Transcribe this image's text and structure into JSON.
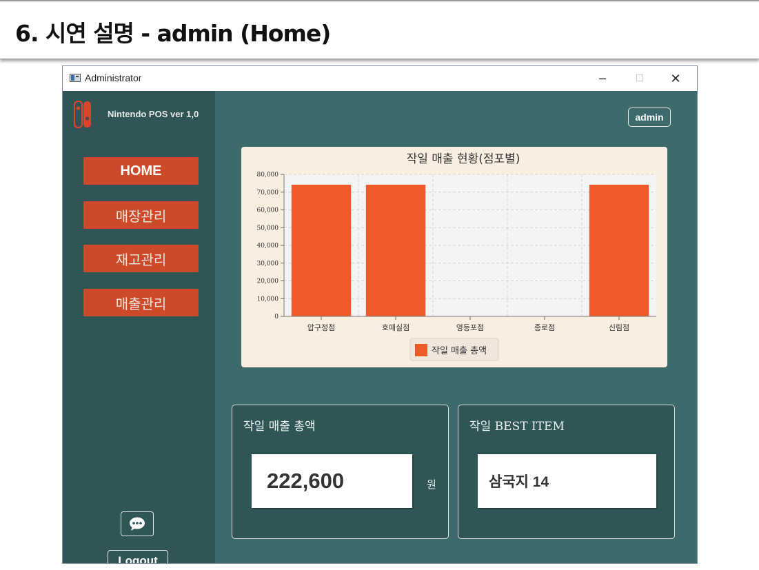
{
  "slide": {
    "title": "6. 시연 설명 - admin (Home)"
  },
  "window": {
    "title": "Administrator",
    "controls": {
      "minimize": "─",
      "maximize": "☐",
      "close": "✕"
    }
  },
  "sidebar": {
    "brand": "Nintendo POS ver 1,0",
    "nav": [
      {
        "label": "HOME",
        "active": true
      },
      {
        "label": "매장관리",
        "active": false
      },
      {
        "label": "재고관리",
        "active": false
      },
      {
        "label": "매출관리",
        "active": false
      }
    ],
    "chat_icon": "chat-bubble-icon",
    "logout_label": "Logout"
  },
  "header": {
    "user_badge": "admin"
  },
  "colors": {
    "sidebar_bg": "#2f5556",
    "main_bg": "#3d6b6b",
    "accent": "#cc4a2a",
    "bar": "#ee5a2a",
    "chart_bg": "#faeee0"
  },
  "chart_data": {
    "type": "bar",
    "title": "작일 매출 현황(점포별)",
    "categories": [
      "압구정점",
      "호매실점",
      "영등포점",
      "종로점",
      "신림점"
    ],
    "series": [
      {
        "name": "작일 매출 총액",
        "values": [
          74200,
          74200,
          0,
          0,
          74200
        ]
      }
    ],
    "ylim": [
      0,
      80000
    ],
    "yticks": [
      "0",
      "10,000",
      "20,000",
      "30,000",
      "40,000",
      "50,000",
      "60,000",
      "70,000",
      "80,000"
    ],
    "grid": true,
    "legend_position": "bottom"
  },
  "cards": {
    "sales": {
      "title": "작일 매출 총액",
      "value": "222,600",
      "unit": "원"
    },
    "best": {
      "title": "작일 BEST ITEM",
      "value": "삼국지 14"
    }
  }
}
